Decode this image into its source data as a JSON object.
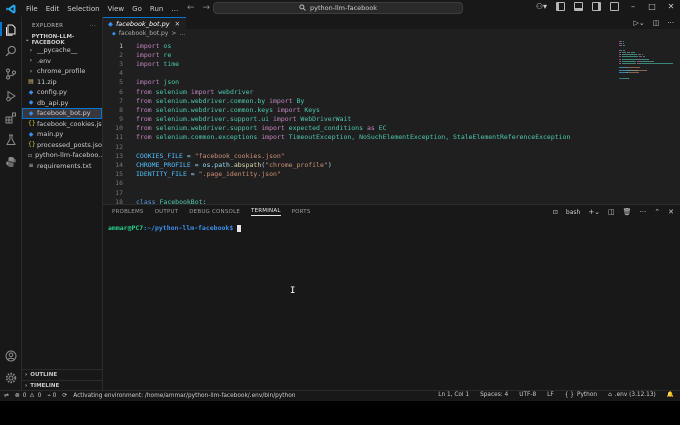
{
  "colors": {
    "accent": "#0078d4",
    "background": "#1f1f1f",
    "chrome": "#181818",
    "terminal_user": "#23d18b",
    "terminal_path": "#3b8eea"
  },
  "titlebar": {
    "menu": [
      "File",
      "Edit",
      "Selection",
      "View",
      "Go",
      "Run",
      "…"
    ],
    "search_text": "python-llm-facebook"
  },
  "sidebar": {
    "header": "EXPLORER",
    "project": "PYTHON-LLM-FACEBOOK",
    "items": [
      {
        "label": "__pycache__",
        "icon": "chevron-right-icon",
        "selected": false
      },
      {
        "label": ".env",
        "icon": "chevron-right-icon",
        "selected": false
      },
      {
        "label": "chrome_profile",
        "icon": "chevron-right-icon",
        "selected": false
      },
      {
        "label": "11.zip",
        "icon": "zip-file-icon",
        "selected": false
      },
      {
        "label": "config.py",
        "icon": "python-file-icon",
        "selected": false
      },
      {
        "label": "db_api.py",
        "icon": "python-file-icon",
        "selected": false
      },
      {
        "label": "facebook_bot.py",
        "icon": "python-file-icon",
        "selected": true
      },
      {
        "label": "facebook_cookies.json",
        "icon": "json-file-icon",
        "selected": false
      },
      {
        "label": "main.py",
        "icon": "python-file-icon",
        "selected": false
      },
      {
        "label": "processed_posts.json",
        "icon": "json-file-icon",
        "selected": false
      },
      {
        "label": "python-llm-faceboo...",
        "icon": "file-icon",
        "selected": false
      },
      {
        "label": "requirements.txt",
        "icon": "text-file-icon",
        "selected": false
      }
    ],
    "outline": "OUTLINE",
    "timeline": "TIMELINE"
  },
  "editor": {
    "tab_label": "facebook_bot.py",
    "breadcrumb": [
      "facebook_bot.py",
      ">",
      "..."
    ],
    "current_line": 1,
    "lines": [
      [
        [
          "kw",
          "import"
        ],
        [
          "plain",
          " "
        ],
        [
          "mod",
          "os"
        ]
      ],
      [
        [
          "kw",
          "import"
        ],
        [
          "plain",
          " "
        ],
        [
          "mod",
          "re"
        ]
      ],
      [
        [
          "kw",
          "import"
        ],
        [
          "plain",
          " "
        ],
        [
          "mod",
          "time"
        ]
      ],
      [],
      [
        [
          "kw",
          "import"
        ],
        [
          "plain",
          " "
        ],
        [
          "mod",
          "json"
        ]
      ],
      [
        [
          "kw",
          "from"
        ],
        [
          "plain",
          " "
        ],
        [
          "mod",
          "selenium"
        ],
        [
          "plain",
          " "
        ],
        [
          "kw",
          "import"
        ],
        [
          "plain",
          " "
        ],
        [
          "mod",
          "webdriver"
        ]
      ],
      [
        [
          "kw",
          "from"
        ],
        [
          "plain",
          " "
        ],
        [
          "mod",
          "selenium.webdriver.common.by"
        ],
        [
          "plain",
          " "
        ],
        [
          "kw",
          "import"
        ],
        [
          "plain",
          " "
        ],
        [
          "mod",
          "By"
        ]
      ],
      [
        [
          "kw",
          "from"
        ],
        [
          "plain",
          " "
        ],
        [
          "mod",
          "selenium.webdriver.common.keys"
        ],
        [
          "plain",
          " "
        ],
        [
          "kw",
          "import"
        ],
        [
          "plain",
          " "
        ],
        [
          "mod",
          "Keys"
        ]
      ],
      [
        [
          "kw",
          "from"
        ],
        [
          "plain",
          " "
        ],
        [
          "mod",
          "selenium.webdriver.support.ui"
        ],
        [
          "plain",
          " "
        ],
        [
          "kw",
          "import"
        ],
        [
          "plain",
          " "
        ],
        [
          "mod",
          "WebDriverWait"
        ]
      ],
      [
        [
          "kw",
          "from"
        ],
        [
          "plain",
          " "
        ],
        [
          "mod",
          "selenium.webdriver.support"
        ],
        [
          "plain",
          " "
        ],
        [
          "kw",
          "import"
        ],
        [
          "plain",
          " "
        ],
        [
          "mod",
          "expected_conditions"
        ],
        [
          "plain",
          " "
        ],
        [
          "kw",
          "as"
        ],
        [
          "plain",
          " "
        ],
        [
          "mod",
          "EC"
        ]
      ],
      [
        [
          "kw",
          "from"
        ],
        [
          "plain",
          " "
        ],
        [
          "mod",
          "selenium.common.exceptions"
        ],
        [
          "plain",
          " "
        ],
        [
          "kw",
          "import"
        ],
        [
          "plain",
          " "
        ],
        [
          "mod",
          "TimeoutException, NoSuchElementException, StaleElementReferenceException"
        ]
      ],
      [],
      [
        [
          "var",
          "COOKIES_FILE"
        ],
        [
          "plain",
          " = "
        ],
        [
          "str",
          "\"facebook_cookies.json\""
        ]
      ],
      [
        [
          "var",
          "CHROME_PROFILE"
        ],
        [
          "plain",
          " = "
        ],
        [
          "plain",
          "os.path."
        ],
        [
          "fn",
          "abspath"
        ],
        [
          "plain",
          "("
        ],
        [
          "str",
          "\"chrome_profile\""
        ],
        [
          "plain",
          ")"
        ]
      ],
      [
        [
          "var",
          "IDENTITY_FILE"
        ],
        [
          "plain",
          " = "
        ],
        [
          "str",
          "\".page_identity.json\""
        ]
      ],
      [],
      [],
      [
        [
          "def",
          "class"
        ],
        [
          "plain",
          " "
        ],
        [
          "mod",
          "FacebookBot"
        ],
        [
          "plain",
          ":"
        ]
      ]
    ]
  },
  "panel": {
    "tabs": [
      "PROBLEMS",
      "OUTPUT",
      "DEBUG CONSOLE",
      "TERMINAL",
      "PORTS"
    ],
    "active_tab": "TERMINAL",
    "shell": "bash",
    "prompt_user": "ammar@PC7",
    "prompt_path": ":~/python-llm-facebook$"
  },
  "statusbar": {
    "errors": "0",
    "warnings": "0",
    "message": "Activating environment: /home/ammar/python-llm-facebook/.env/bin/python",
    "position": "Ln 1, Col 1",
    "spaces": "Spaces: 4",
    "encoding": "UTF-8",
    "eol": "LF",
    "language": "Python",
    "interpreter": ".env (3.12.13)"
  }
}
